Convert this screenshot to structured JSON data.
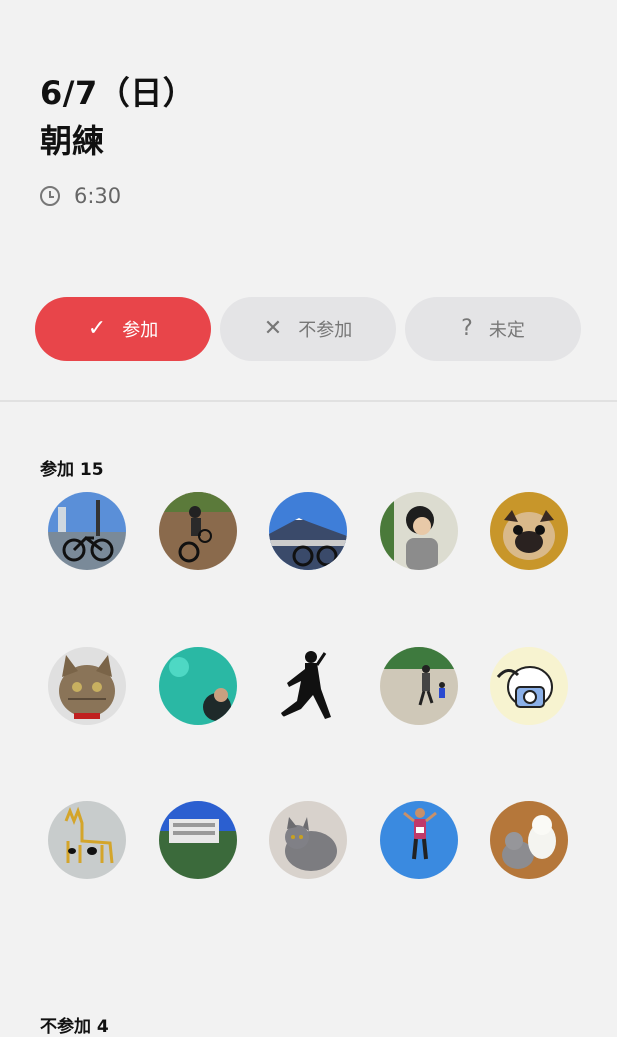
{
  "event": {
    "date": "6/7（日）",
    "title": "朝練",
    "time": "6:30"
  },
  "rsvp": {
    "attend_label": "参加",
    "absent_label": "不参加",
    "undecided_label": "未定",
    "attend_icon": "✓",
    "absent_icon": "✕",
    "undecided_icon": "?",
    "selected": "attend",
    "accent_color": "#e8454a"
  },
  "attending": {
    "label": "参加 15",
    "members": [
      {
        "avatar": "bicycle-harbor-avatar"
      },
      {
        "avatar": "mountain-biker-avatar"
      },
      {
        "avatar": "mount-fuji-bike-avatar"
      },
      {
        "avatar": "child-avatar"
      },
      {
        "avatar": "pug-avatar"
      },
      {
        "avatar": "tabby-cat-avatar"
      },
      {
        "avatar": "aquarium-avatar"
      },
      {
        "avatar": "silhouette-avatar"
      },
      {
        "avatar": "runners-avatar"
      },
      {
        "avatar": "cartoon-dog-avatar"
      },
      {
        "avatar": "cow-drawing-avatar"
      },
      {
        "avatar": "building-avatar"
      },
      {
        "avatar": "gray-cat-avatar"
      },
      {
        "avatar": "marathon-runner-avatar"
      },
      {
        "avatar": "cat-and-dog-avatar"
      }
    ]
  },
  "not_attending": {
    "label": "不参加 4"
  }
}
